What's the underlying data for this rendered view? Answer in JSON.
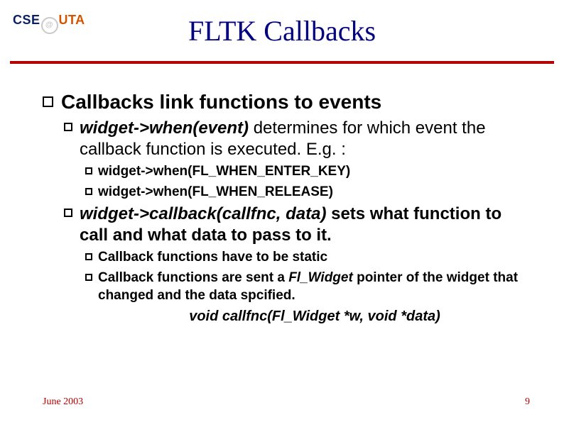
{
  "logo": {
    "cse": "CSE",
    "uta": "UTA"
  },
  "title": "FLTK Callbacks",
  "content": {
    "l1": "Callbacks link functions to events",
    "sub1": {
      "bold": "widget->when(event)",
      "rest": "   determines for which event the callback function is executed. E.g. :",
      "ex1": "widget->when(FL_WHEN_ENTER_KEY)",
      "ex2": "widget->when(FL_WHEN_RELEASE)"
    },
    "sub2": {
      "bold": "widget->callback(callfnc, data)",
      "rest": "    sets what function to call and what data to pass to it.",
      "note1": "Callback functions have to be static",
      "note2_a": "Callback functions are sent a ",
      "note2_b": "Fl_Widget",
      "note2_c": " pointer of the widget that changed and the data spcified.",
      "code": "void callfnc(Fl_Widget *w, void *data)"
    }
  },
  "footer": {
    "date": "June 2003",
    "page": "9"
  }
}
